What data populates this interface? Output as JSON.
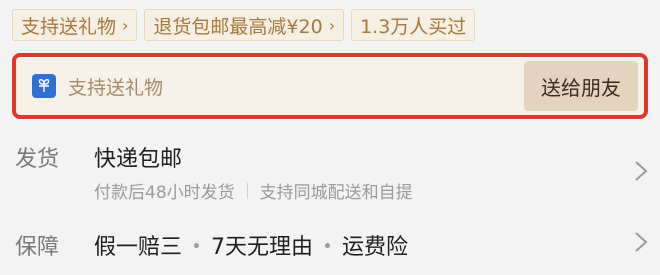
{
  "tags": [
    {
      "label": "支持送礼物",
      "chevron": "›"
    },
    {
      "label": "退货包邮最高减¥20",
      "chevron": "›"
    },
    {
      "label": "1.3万人买过"
    }
  ],
  "gift_bar": {
    "icon": "gift-box-icon",
    "text": "支持送礼物",
    "button_label": "送给朋友",
    "highlight_color": "#e0372c"
  },
  "shipping": {
    "label": "发货",
    "title": "快递包邮",
    "details": [
      "付款后48小时发货",
      "支持同城配送和自提"
    ]
  },
  "guarantee": {
    "label": "保障",
    "items": [
      "假一赔三",
      "7天无理由",
      "运费险"
    ]
  }
}
